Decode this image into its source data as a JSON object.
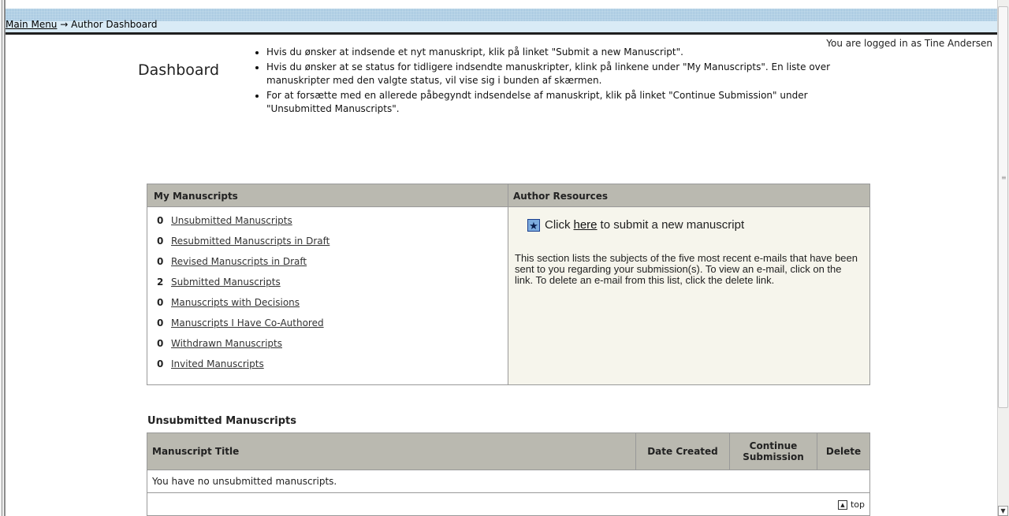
{
  "breadcrumb": {
    "main_menu": "Main Menu",
    "arrow": "→",
    "current": "Author Dashboard"
  },
  "login_text": "You are logged in as Tine Andersen",
  "dashboard": {
    "title": "Dashboard",
    "instructions": [
      "Hvis du ønsker at indsende et nyt manuskript, klik på linket \"Submit a new Manuscript\".",
      "Hvis du ønsker at se status for tidligere indsendte manuskripter, klink på linkene under \"My Manuscripts\". En liste over manuskripter med den valgte status, vil vise sig i bunden af skærmen.",
      "For at forsætte med en allerede påbegyndt indsendelse af manuskript, klik på linket \"Continue Submission\" under \"Unsubmitted Manuscripts\"."
    ]
  },
  "my_manuscripts": {
    "heading": "My Manuscripts",
    "items": [
      {
        "count": "0",
        "label": "Unsubmitted Manuscripts"
      },
      {
        "count": "0",
        "label": "Resubmitted Manuscripts in Draft"
      },
      {
        "count": "0",
        "label": "Revised Manuscripts in Draft"
      },
      {
        "count": "2",
        "label": "Submitted Manuscripts"
      },
      {
        "count": "0",
        "label": "Manuscripts with Decisions"
      },
      {
        "count": "0",
        "label": "Manuscripts I Have Co-Authored"
      },
      {
        "count": "0",
        "label": "Withdrawn Manuscripts"
      },
      {
        "count": "0",
        "label": "Invited Manuscripts"
      }
    ]
  },
  "author_resources": {
    "heading": "Author Resources",
    "submit_prefix": "Click",
    "submit_link": "here",
    "submit_suffix": "to submit a new manuscript",
    "info_text": "This section lists the subjects of the five most recent e-mails that have been sent to you regarding your submission(s). To view an e-mail, click on the link. To delete an e-mail from this list, click the delete link."
  },
  "unsubmitted": {
    "title": "Unsubmitted Manuscripts",
    "columns": {
      "title": "Manuscript Title",
      "date": "Date Created",
      "continue": "Continue Submission",
      "delete": "Delete"
    },
    "empty_message": "You have no unsubmitted manuscripts.",
    "top_link": "top"
  },
  "colors": {
    "header_bar": "#b3d2e7",
    "panel_header": "#bab9b0",
    "resources_bg": "#f6f5ec"
  },
  "icons": [
    "star-icon",
    "arrow-up-icon",
    "scroll-down-icon"
  ]
}
